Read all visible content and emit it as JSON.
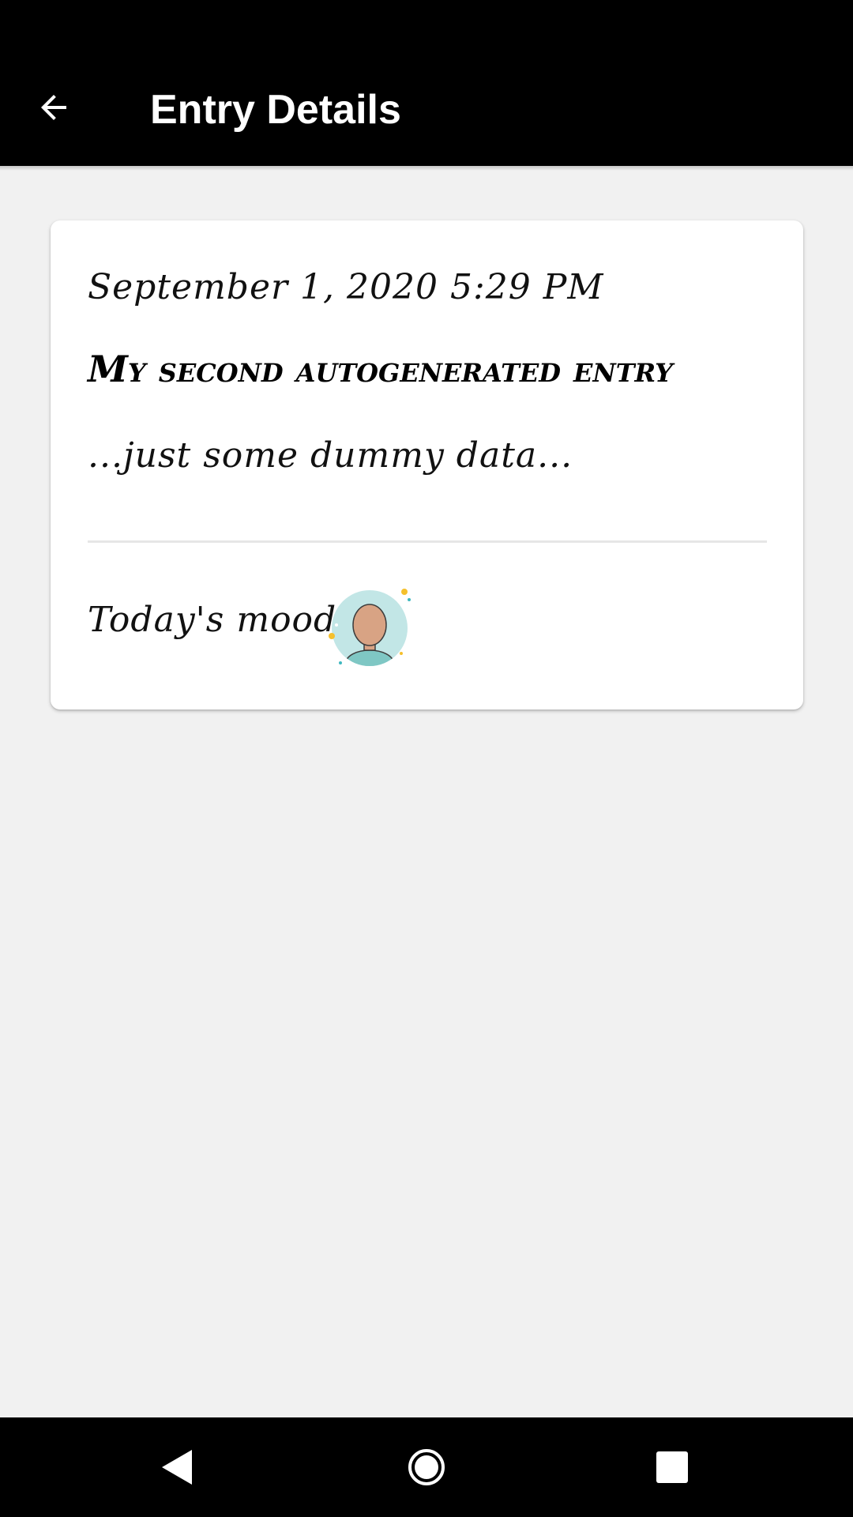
{
  "toolbar": {
    "title": "Entry Details",
    "back_icon": "arrow-back-icon",
    "background_color": "#000000",
    "text_color": "#ffffff"
  },
  "entry": {
    "date": "September 1, 2020 5:29 PM",
    "title": "My second autogenerated entry",
    "body": "...just some dummy data...",
    "mood_label": "Today's mood:",
    "mood_icon": "neutral-person-avatar-icon"
  },
  "navbar": {
    "back_icon": "nav-back-triangle-icon",
    "home_icon": "nav-home-circle-icon",
    "recents_icon": "nav-recents-square-icon"
  },
  "colors": {
    "page_background": "#f1f1f1",
    "card_background": "#ffffff",
    "avatar_circle": "#c2e6e6",
    "avatar_skin": "#d8a384",
    "avatar_shirt": "#7fc7c4",
    "sparkle_yellow": "#f5c02c",
    "sparkle_teal": "#3fb8c0"
  }
}
